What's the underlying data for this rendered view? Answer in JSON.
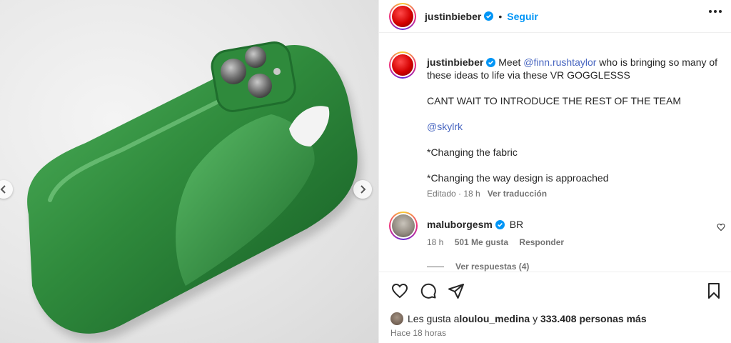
{
  "header": {
    "username": "justinbieber",
    "separator": "•",
    "follow_label": "Seguir"
  },
  "caption": {
    "username": "justinbieber",
    "line1_prefix": "Meet ",
    "line1_mention": "@finn.rushtaylor",
    "line1_suffix": " who is bringing so many of these ideas to life via these VR GOGGLESSS",
    "line2": "CANT WAIT TO INTRODUCE THE REST OF THE TEAM",
    "line3_mention": "@skylrk",
    "line4": "*Changing the fabric",
    "line5": "*Changing the way design is approached",
    "edited": "Editado · 18 h",
    "translate_label": "Ver traducción"
  },
  "comment": {
    "username": "maluborgesm",
    "text": "BR",
    "time": "18 h",
    "likes": "501 Me gusta",
    "reply_label": "Responder",
    "view_replies": "Ver respuestas (4)"
  },
  "footer": {
    "likes_prefix": "Les gusta a ",
    "likes_user": "loulou_medina",
    "likes_mid": " y ",
    "likes_count": "333.408 personas más",
    "time": "Hace 18 horas"
  },
  "icons": {
    "like": "heart-icon",
    "comment": "comment-icon",
    "share": "send-icon",
    "save": "bookmark-icon",
    "more": "more-icon",
    "verified": "verified-icon"
  },
  "colors": {
    "accent": "#0095f6",
    "mention": "#4765c0",
    "phone_case": "#2f8a3c",
    "verified": "#0095f6"
  }
}
